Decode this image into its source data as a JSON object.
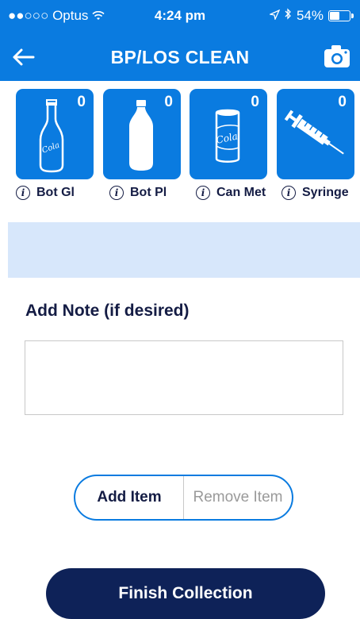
{
  "status_bar": {
    "carrier": "●●○○○ Optus",
    "wifi_icon": "wifi-icon",
    "time": "4:24 pm",
    "location_icon": "location-arrow-icon",
    "bluetooth_icon": "bluetooth-icon",
    "battery": "54%",
    "battery_level": 0.54
  },
  "nav": {
    "title": "BP/LOS CLEAN",
    "back_icon": "back-arrow-icon",
    "camera_icon": "camera-icon"
  },
  "items": [
    {
      "label": "Bot Gl",
      "count": "0",
      "icon": "glass-bottle-icon"
    },
    {
      "label": "Bot Pl",
      "count": "0",
      "icon": "plastic-bottle-icon"
    },
    {
      "label": "Can Met",
      "count": "0",
      "icon": "can-icon"
    },
    {
      "label": "Syringe",
      "count": "0",
      "icon": "syringe-icon"
    }
  ],
  "icon_text": {
    "bottle": "Cola",
    "can": "Cola"
  },
  "note": {
    "label": "Add Note (if desired)",
    "value": ""
  },
  "actions": {
    "add": "Add Item",
    "remove": "Remove Item",
    "finish": "Finish Collection"
  },
  "colors": {
    "primary": "#0a7be0",
    "dark": "#0e2258",
    "band": "#d7e7fb"
  }
}
